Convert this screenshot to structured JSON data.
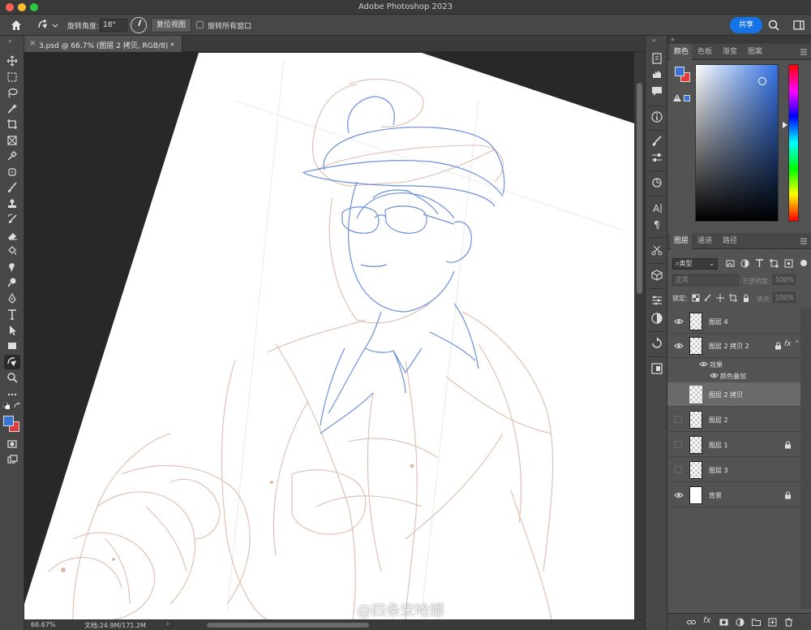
{
  "window": {
    "title": "Adobe Photoshop 2023"
  },
  "options_bar": {
    "rotate_angle_label": "旋转角度:",
    "rotate_angle_value": "18°",
    "reset_view_label": "复位视图",
    "rotate_all_label": "旋转所有窗口",
    "share_label": "共享"
  },
  "document": {
    "tab_title": "3.psd @ 66.7% (图层 2 拷贝, RGB/8) *",
    "zoom": "66.67%",
    "size": "文档:24.9M/171.2M",
    "canvas_rotation_deg": 18
  },
  "color_panel": {
    "tabs": [
      "颜色",
      "色板",
      "渐变",
      "图案"
    ],
    "active_tab": "颜色",
    "foreground": "#3a71d6",
    "background": "#e03a3a"
  },
  "layers_panel": {
    "tabs": [
      "图层",
      "通道",
      "路径"
    ],
    "filter_label": "类型",
    "blend_mode": "正常",
    "opacity_label": "不透明度:",
    "opacity_value": "100%",
    "lock_label": "锁定:",
    "fill_label": "填充:",
    "fill_value": "100%",
    "layers": [
      {
        "name": "图层 4",
        "visible": true,
        "locked": false
      },
      {
        "name": "图层 2 拷贝 2",
        "visible": true,
        "locked": true,
        "fx": "fx"
      },
      {
        "name": "图层 2 拷贝",
        "visible": false,
        "locked": false,
        "selected": true
      },
      {
        "name": "图层 2",
        "visible": false,
        "locked": false
      },
      {
        "name": "图层 1",
        "visible": false,
        "locked": true
      },
      {
        "name": "图层 3",
        "visible": false,
        "locked": false
      },
      {
        "name": "背景",
        "visible": true,
        "locked": true
      }
    ],
    "effects_label": "效果",
    "effect_name": "颜色叠加"
  },
  "watermark": "@四条宋哈娜"
}
